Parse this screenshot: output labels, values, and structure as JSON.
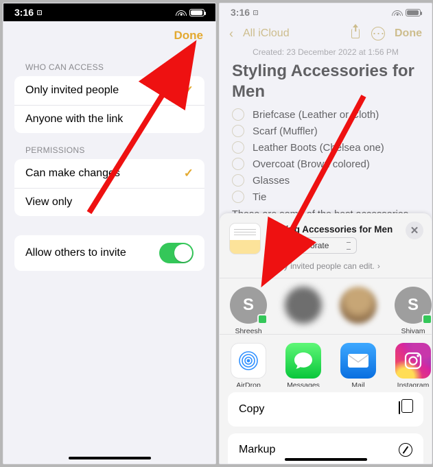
{
  "status": {
    "time": "3:16"
  },
  "left": {
    "done": "Done",
    "access_label": "WHO CAN ACCESS",
    "access": {
      "only_invited": "Only invited people",
      "anyone": "Anyone with the link"
    },
    "permissions_label": "PERMISSIONS",
    "permissions": {
      "can_make_changes": "Can make changes",
      "view_only": "View only"
    },
    "allow_others": "Allow others to invite"
  },
  "right": {
    "back_label": "All iCloud",
    "done": "Done",
    "created": "Created: 23 December 2022 at 1:56 PM",
    "title": "Styling Accessories for Men",
    "items": {
      "briefcase": "Briefcase (Leather or Cloth)",
      "scarf": "Scarf (Muffler)",
      "boots": "Leather Boots (Chelsea one)",
      "overcoat": "Overcoat (Brown colored)",
      "glasses": "Glasses",
      "tie": "Tie"
    },
    "paragraph": "These are some of the best accessories for"
  },
  "share": {
    "title": "Styling Accessories for Men",
    "mode": "Collaborate",
    "subline": "Only invited people can edit.",
    "people": {
      "shreesh": "Shreesh",
      "blank1": " ",
      "blank2": " ",
      "shivam": "Shivam"
    },
    "apps": {
      "airdrop": "AirDrop",
      "messages": "Messages",
      "mail": "Mail",
      "instagram": "Instagram"
    },
    "actions": {
      "copy": "Copy",
      "markup": "Markup"
    }
  }
}
